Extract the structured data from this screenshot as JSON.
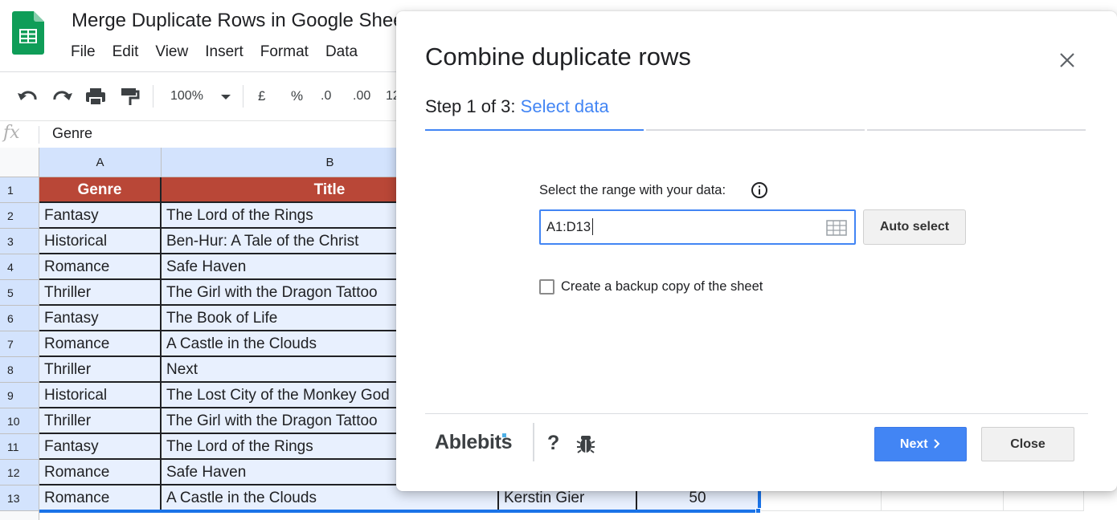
{
  "doc": {
    "title": "Merge Duplicate Rows in Google Sheets"
  },
  "menu": [
    "File",
    "Edit",
    "View",
    "Insert",
    "Format",
    "Data"
  ],
  "toolbar": {
    "zoom": "100%",
    "currency": "£",
    "percent": "%",
    "dec_less": ".0",
    "dec_more": ".00",
    "format_more": "12"
  },
  "formula_bar": {
    "fx": "fx",
    "value": "Genre"
  },
  "columns": [
    "A",
    "B"
  ],
  "row_numbers": [
    "1",
    "2",
    "3",
    "4",
    "5",
    "6",
    "7",
    "8",
    "9",
    "10",
    "11",
    "12",
    "13"
  ],
  "rows": [
    {
      "genre": "Genre",
      "title": "Title"
    },
    {
      "genre": "Fantasy",
      "title": "The Lord of the Rings"
    },
    {
      "genre": "Historical",
      "title": "Ben-Hur: A Tale of the Christ"
    },
    {
      "genre": "Romance",
      "title": "Safe Haven"
    },
    {
      "genre": "Thriller",
      "title": "The Girl with the Dragon Tattoo"
    },
    {
      "genre": "Fantasy",
      "title": "The Book of Life"
    },
    {
      "genre": "Romance",
      "title": "A Castle in the Clouds"
    },
    {
      "genre": "Thriller",
      "title": "Next"
    },
    {
      "genre": "Historical",
      "title": "The Lost City of the Monkey God"
    },
    {
      "genre": "Thriller",
      "title": "The Girl with the Dragon Tattoo"
    },
    {
      "genre": "Fantasy",
      "title": "The Lord of the Rings"
    },
    {
      "genre": "Romance",
      "title": "Safe Haven"
    },
    {
      "genre": "Romance",
      "title": "A Castle in the Clouds",
      "author": "Kerstin Gier",
      "value": "50"
    }
  ],
  "dialog": {
    "title": "Combine duplicate rows",
    "step_prefix": "Step 1 of 3:",
    "step_name": "Select data",
    "range_label": "Select the range with your data:",
    "range_value": "A1:D13",
    "auto_select": "Auto select",
    "backup_label": "Create a backup copy of the sheet",
    "brand": "Ablebits",
    "help": "?",
    "next": "Next",
    "close": "Close",
    "accent_color": "#4285f4"
  },
  "colors": {
    "header_fill": "#b94737",
    "selection_fill": "#e8f0fe",
    "selection_border": "#1a73e8"
  }
}
